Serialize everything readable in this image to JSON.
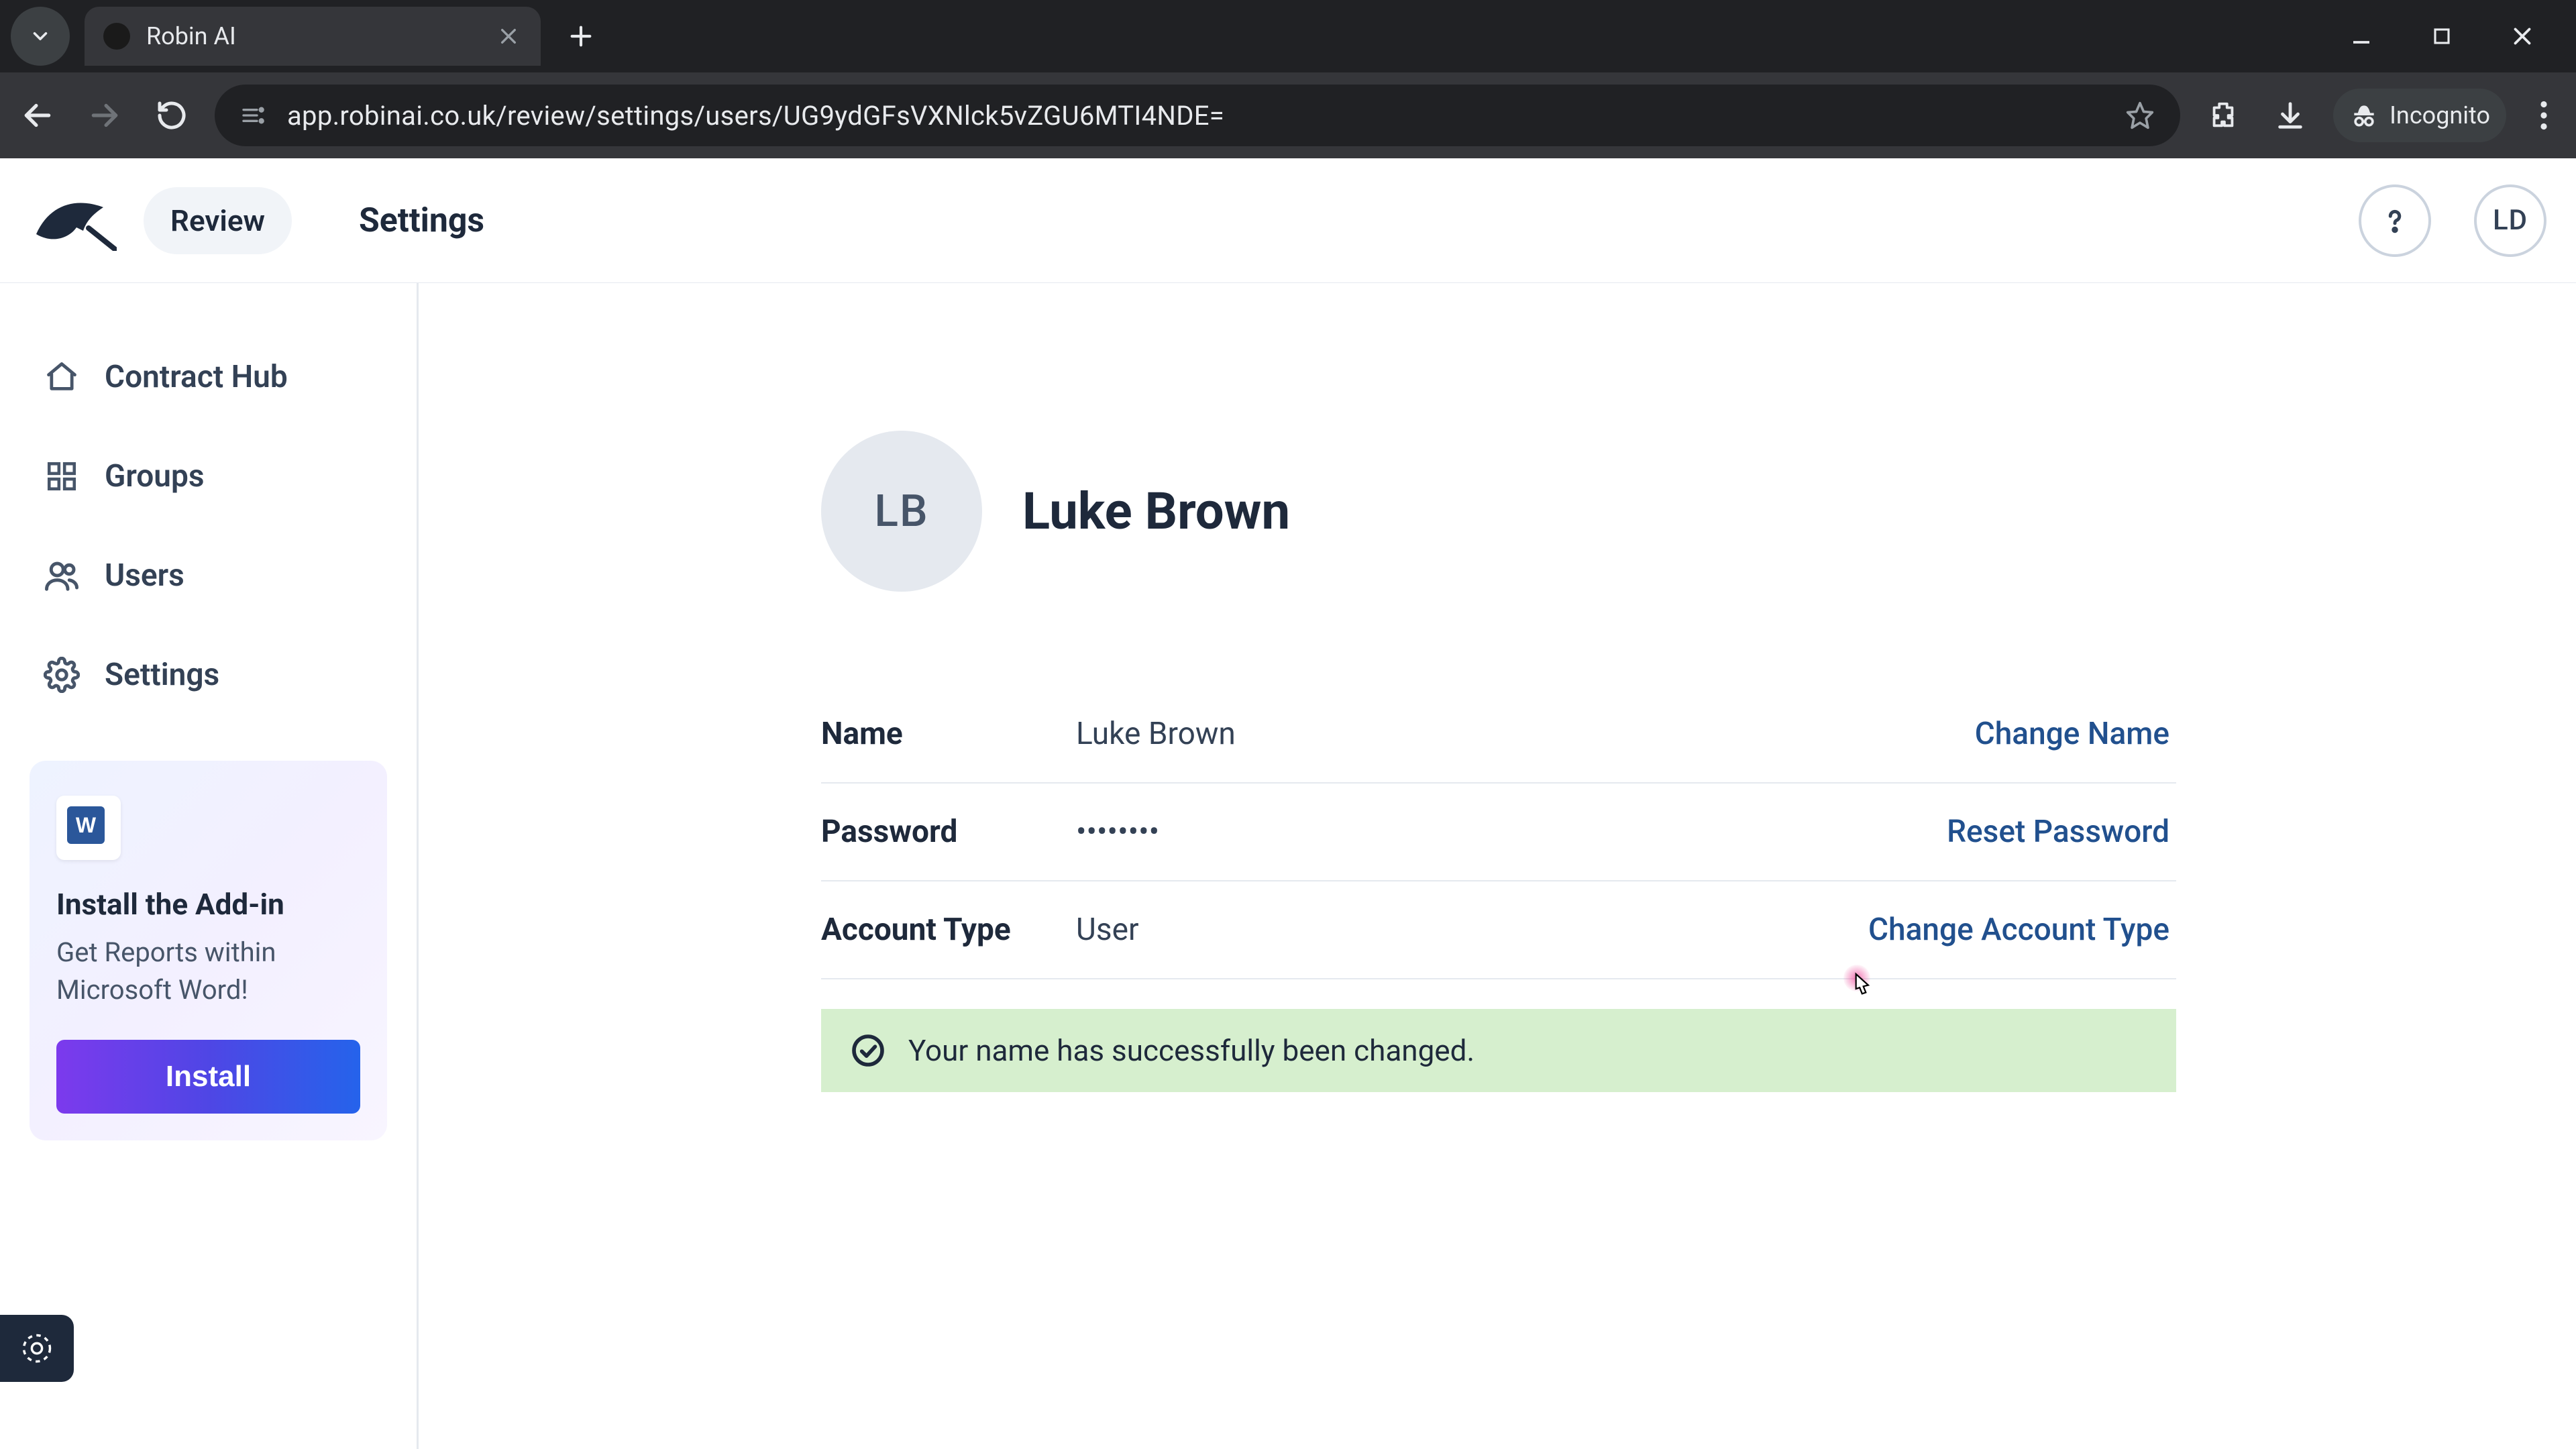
{
  "browser": {
    "tab_title": "Robin AI",
    "url": "app.robinai.co.uk/review/settings/users/UG9ydGFsVXNlck5vZGU6MTI4NDE=",
    "incognito_label": "Incognito"
  },
  "header": {
    "nav_pill": "Review",
    "title": "Settings",
    "current_user_initials": "LD"
  },
  "sidebar": {
    "items": [
      {
        "label": "Contract Hub"
      },
      {
        "label": "Groups"
      },
      {
        "label": "Users"
      },
      {
        "label": "Settings"
      }
    ],
    "promo": {
      "title": "Install the Add-in",
      "body": "Get Reports within Microsoft Word!",
      "button": "Install"
    }
  },
  "profile": {
    "initials": "LB",
    "full_name": "Luke Brown",
    "fields": [
      {
        "label": "Name",
        "value": "Luke Brown",
        "action": "Change Name"
      },
      {
        "label": "Password",
        "value": "••••••••",
        "action": "Reset Password"
      },
      {
        "label": "Account Type",
        "value": "User",
        "action": "Change Account Type"
      }
    ],
    "alert": "Your name has successfully been changed."
  },
  "colors": {
    "link": "#21508e",
    "success_bg": "#d6efce",
    "text": "#1e293b"
  }
}
